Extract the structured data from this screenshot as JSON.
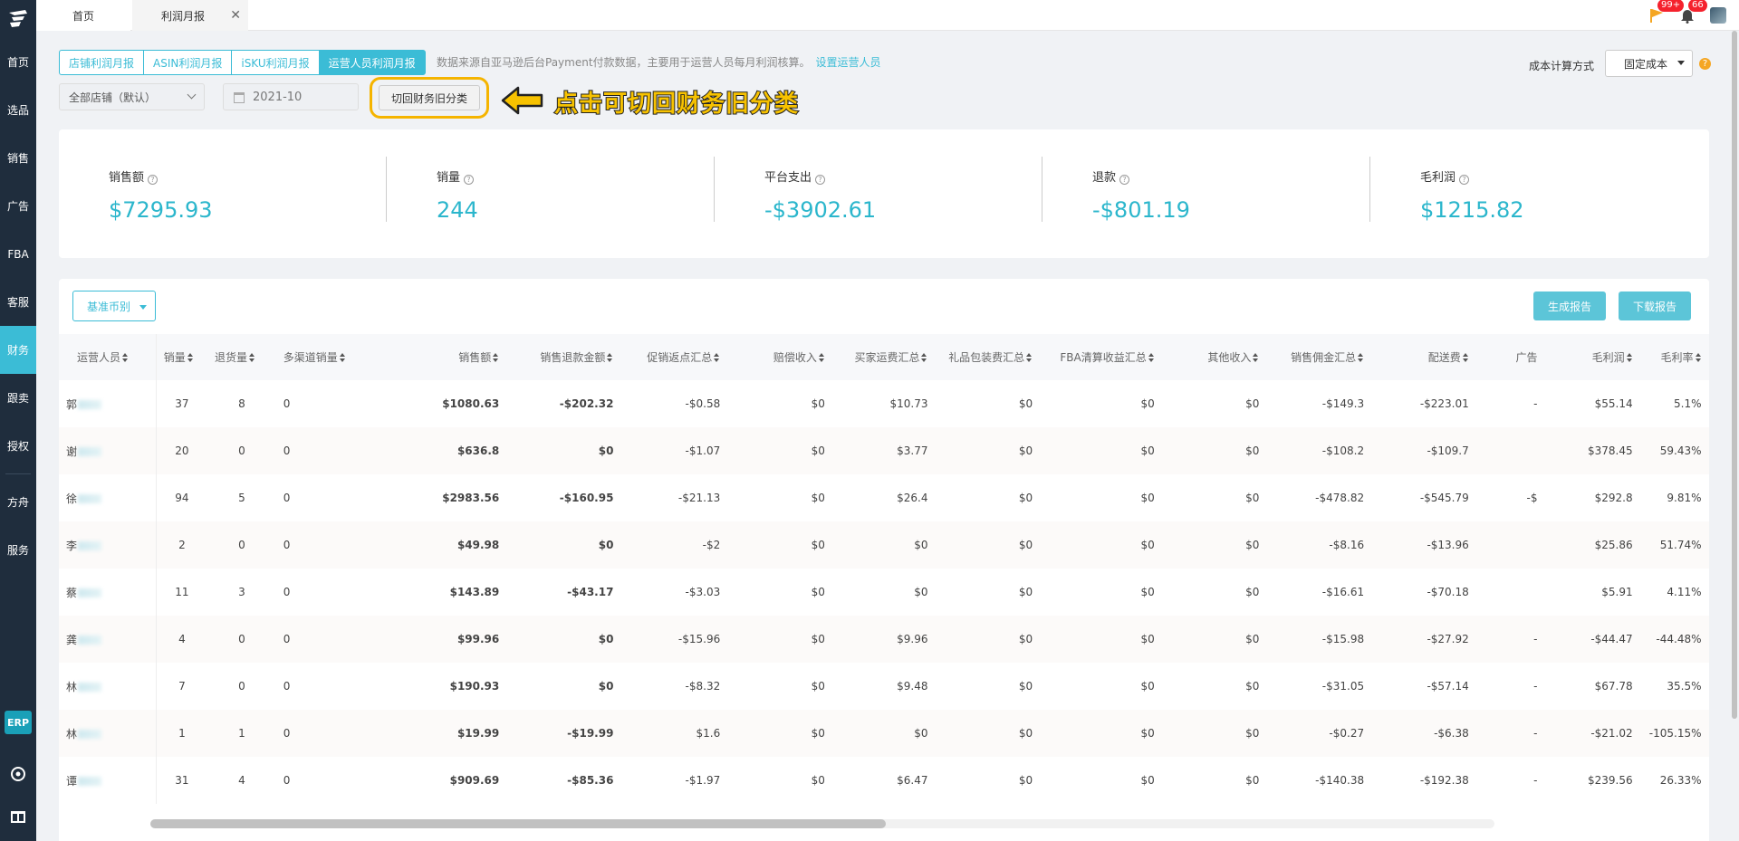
{
  "sidebar": {
    "items": [
      {
        "label": "首页"
      },
      {
        "label": "选品"
      },
      {
        "label": "销售"
      },
      {
        "label": "广告"
      },
      {
        "label": "FBA"
      },
      {
        "label": "客服"
      },
      {
        "label": "财务",
        "active": true
      },
      {
        "label": "跟卖"
      },
      {
        "label": "授权"
      },
      {
        "label": "方舟"
      },
      {
        "label": "服务"
      }
    ],
    "erp_label": "ERP"
  },
  "topbar": {
    "tabs": [
      {
        "label": "首页"
      },
      {
        "label": "利润月报"
      }
    ],
    "flag_badge": "99+",
    "bell_badge": "66"
  },
  "report_tabs": [
    {
      "label": "店铺利润月报"
    },
    {
      "label": "ASIN利润月报"
    },
    {
      "label": "iSKU利润月报"
    },
    {
      "label": "运营人员利润月报",
      "active": true
    }
  ],
  "info": {
    "text": "数据来源自亚马逊后台Payment付款数据，主要用于运营人员每月利润核算。",
    "link": "设置运营人员"
  },
  "cost": {
    "label": "成本计算方式",
    "value": "固定成本"
  },
  "filters": {
    "shop": "全部店铺（默认）",
    "date": "2021-10",
    "switch_button": "切回财务旧分类"
  },
  "callout": "点击可切回财务旧分类",
  "stats": [
    {
      "label": "销售额",
      "value": "$7295.93"
    },
    {
      "label": "销量",
      "value": "244"
    },
    {
      "label": "平台支出",
      "value": "-$3902.61"
    },
    {
      "label": "退款",
      "value": "-$801.19"
    },
    {
      "label": "毛利润",
      "value": "$1215.82"
    }
  ],
  "table": {
    "currency_button": "基准币别",
    "generate_button": "生成报告",
    "download_button": "下载报告",
    "columns": [
      "运营人员",
      "销量",
      "退货量",
      "多渠道销量",
      "销售额",
      "销售退款金额",
      "促销返点汇总",
      "赔偿收入",
      "买家运费汇总",
      "礼品包装费汇总",
      "FBA清算收益汇总",
      "其他收入",
      "销售佣金汇总",
      "配送费",
      "广告",
      "毛利润",
      "毛利率"
    ],
    "rows": [
      [
        "郭",
        "37",
        "8",
        "0",
        "$1080.63",
        "-$202.32",
        "-$0.58",
        "$0",
        "$10.73",
        "$0",
        "$0",
        "$0",
        "-$149.3",
        "-$223.01",
        "-",
        "$55.14",
        "5.1%"
      ],
      [
        "谢",
        "20",
        "0",
        "0",
        "$636.8",
        "$0",
        "-$1.07",
        "$0",
        "$3.77",
        "$0",
        "$0",
        "$0",
        "-$108.2",
        "-$109.7",
        "",
        "$378.45",
        "59.43%"
      ],
      [
        "徐",
        "94",
        "5",
        "0",
        "$2983.56",
        "-$160.95",
        "-$21.13",
        "$0",
        "$26.4",
        "$0",
        "$0",
        "$0",
        "-$478.82",
        "-$545.79",
        "-$",
        "$292.8",
        "9.81%"
      ],
      [
        "李",
        "2",
        "0",
        "0",
        "$49.98",
        "$0",
        "-$2",
        "$0",
        "$0",
        "$0",
        "$0",
        "$0",
        "-$8.16",
        "-$13.96",
        "",
        "$25.86",
        "51.74%"
      ],
      [
        "蔡",
        "11",
        "3",
        "0",
        "$143.89",
        "-$43.17",
        "-$3.03",
        "$0",
        "$0",
        "$0",
        "$0",
        "$0",
        "-$16.61",
        "-$70.18",
        "",
        "$5.91",
        "4.11%"
      ],
      [
        "龚",
        "4",
        "0",
        "0",
        "$99.96",
        "$0",
        "-$15.96",
        "$0",
        "$9.96",
        "$0",
        "$0",
        "$0",
        "-$15.98",
        "-$27.92",
        "-",
        "-$44.47",
        "-44.48%"
      ],
      [
        "林",
        "7",
        "0",
        "0",
        "$190.93",
        "$0",
        "-$8.32",
        "$0",
        "$9.48",
        "$0",
        "$0",
        "$0",
        "-$31.05",
        "-$57.14",
        "-",
        "$67.78",
        "35.5%"
      ],
      [
        "林",
        "1",
        "1",
        "0",
        "$19.99",
        "-$19.99",
        "$1.6",
        "$0",
        "$0",
        "$0",
        "$0",
        "$0",
        "-$0.27",
        "-$6.38",
        "-",
        "-$21.02",
        "-105.15%"
      ],
      [
        "谭",
        "31",
        "4",
        "0",
        "$909.69",
        "-$85.36",
        "-$1.97",
        "$0",
        "$6.47",
        "$0",
        "$0",
        "$0",
        "-$140.38",
        "-$192.38",
        "-",
        "$239.56",
        "26.33%"
      ]
    ]
  }
}
